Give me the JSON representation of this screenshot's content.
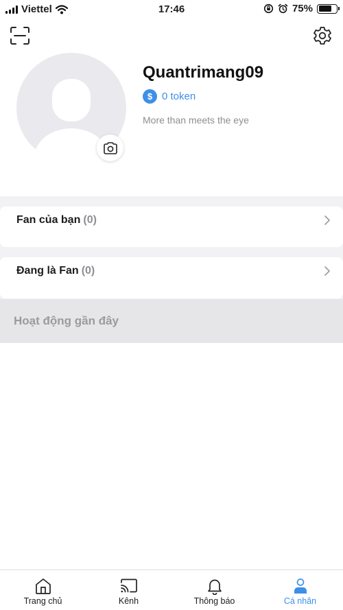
{
  "status_bar": {
    "carrier": "Viettel",
    "time": "17:46",
    "battery": "75%",
    "battery_level": 0.75
  },
  "header": {
    "scan_icon": "scan-icon",
    "settings_icon": "gear-icon"
  },
  "profile": {
    "username": "Quantrimang09",
    "token_symbol": "$",
    "token_text": "0 token",
    "bio": "More than meets the eye"
  },
  "lists": {
    "fans": {
      "label": "Fan của bạn",
      "count": "(0)"
    },
    "following": {
      "label": "Đang là Fan",
      "count": "(0)"
    },
    "recent": {
      "label": "Hoạt động gần đây"
    }
  },
  "bottom_nav": {
    "items": [
      {
        "label": "Trang chủ",
        "icon": "home-icon",
        "active": false
      },
      {
        "label": "Kênh",
        "icon": "cast-icon",
        "active": false
      },
      {
        "label": "Thông báo",
        "icon": "bell-icon",
        "active": false
      },
      {
        "label": "Cá nhân",
        "icon": "person-icon",
        "active": true
      }
    ]
  },
  "colors": {
    "accent": "#3d8fe8",
    "muted_text": "#8e8e93",
    "section_bg": "#f2f2f4"
  }
}
